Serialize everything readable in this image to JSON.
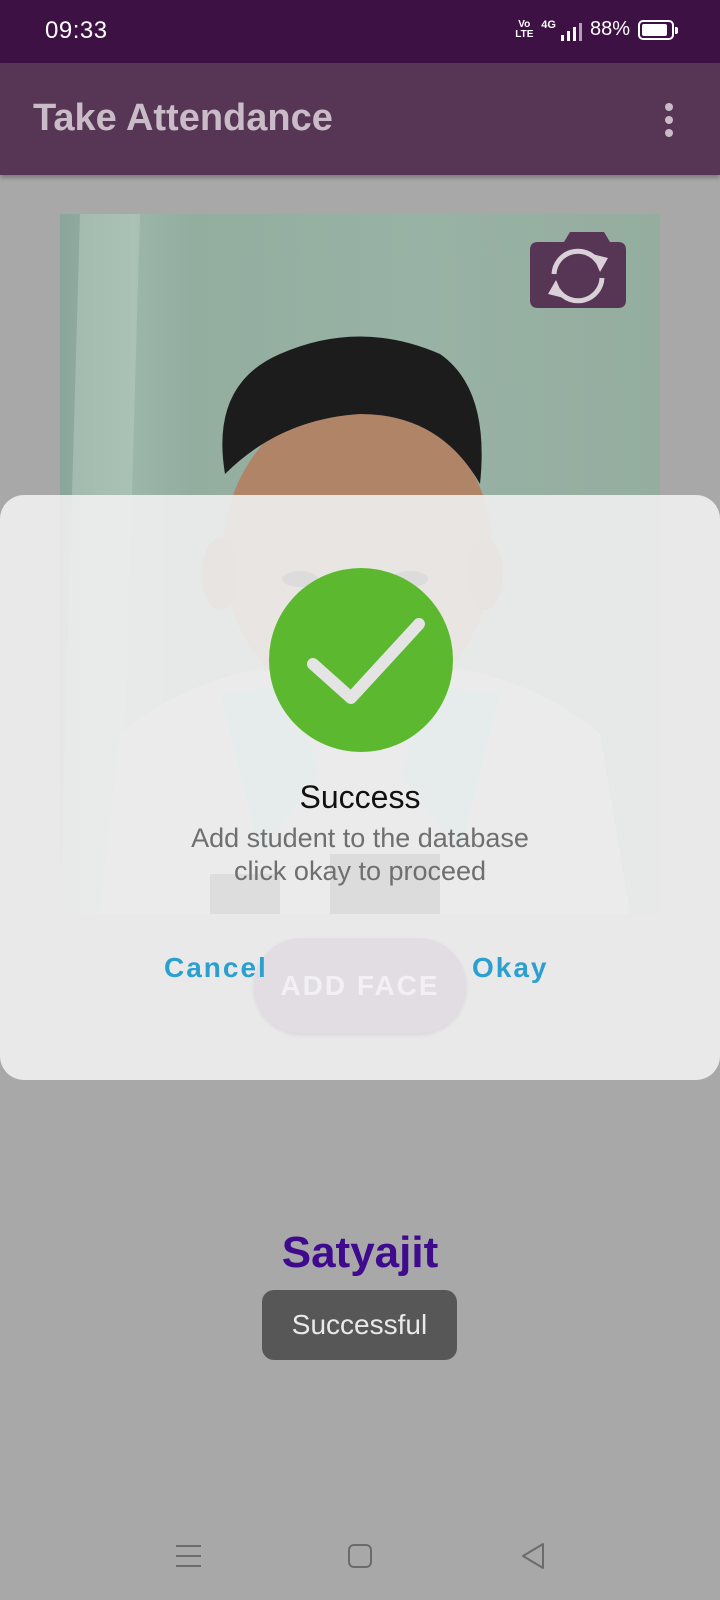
{
  "status_bar": {
    "time": "09:33",
    "volte": "Vo LTE",
    "network": "4G",
    "battery_percent": "88%",
    "battery_level": 0.88
  },
  "app_bar": {
    "title": "Take Attendance",
    "menu_icon": "more-vert-icon"
  },
  "camera": {
    "switch_icon": "switch-camera-icon"
  },
  "dialog": {
    "icon": "success-check-icon",
    "title": "Success",
    "message_line1": "Add student to the database",
    "message_line2": "click okay to proceed",
    "cancel_label": "Cancel",
    "okay_label": "Okay"
  },
  "add_face_label": "ADD FACE",
  "student_name": "Satyajit",
  "toast_text": "Successful",
  "nav": {
    "menu_icon": "recents-icon",
    "home_icon": "home-icon",
    "back_icon": "back-icon"
  },
  "colors": {
    "status_bar": "#3d1144",
    "app_bar": "#573555",
    "success_green": "#5cb82e",
    "dialog_button": "#2b9fcf",
    "student_name": "#3f0a8e"
  }
}
